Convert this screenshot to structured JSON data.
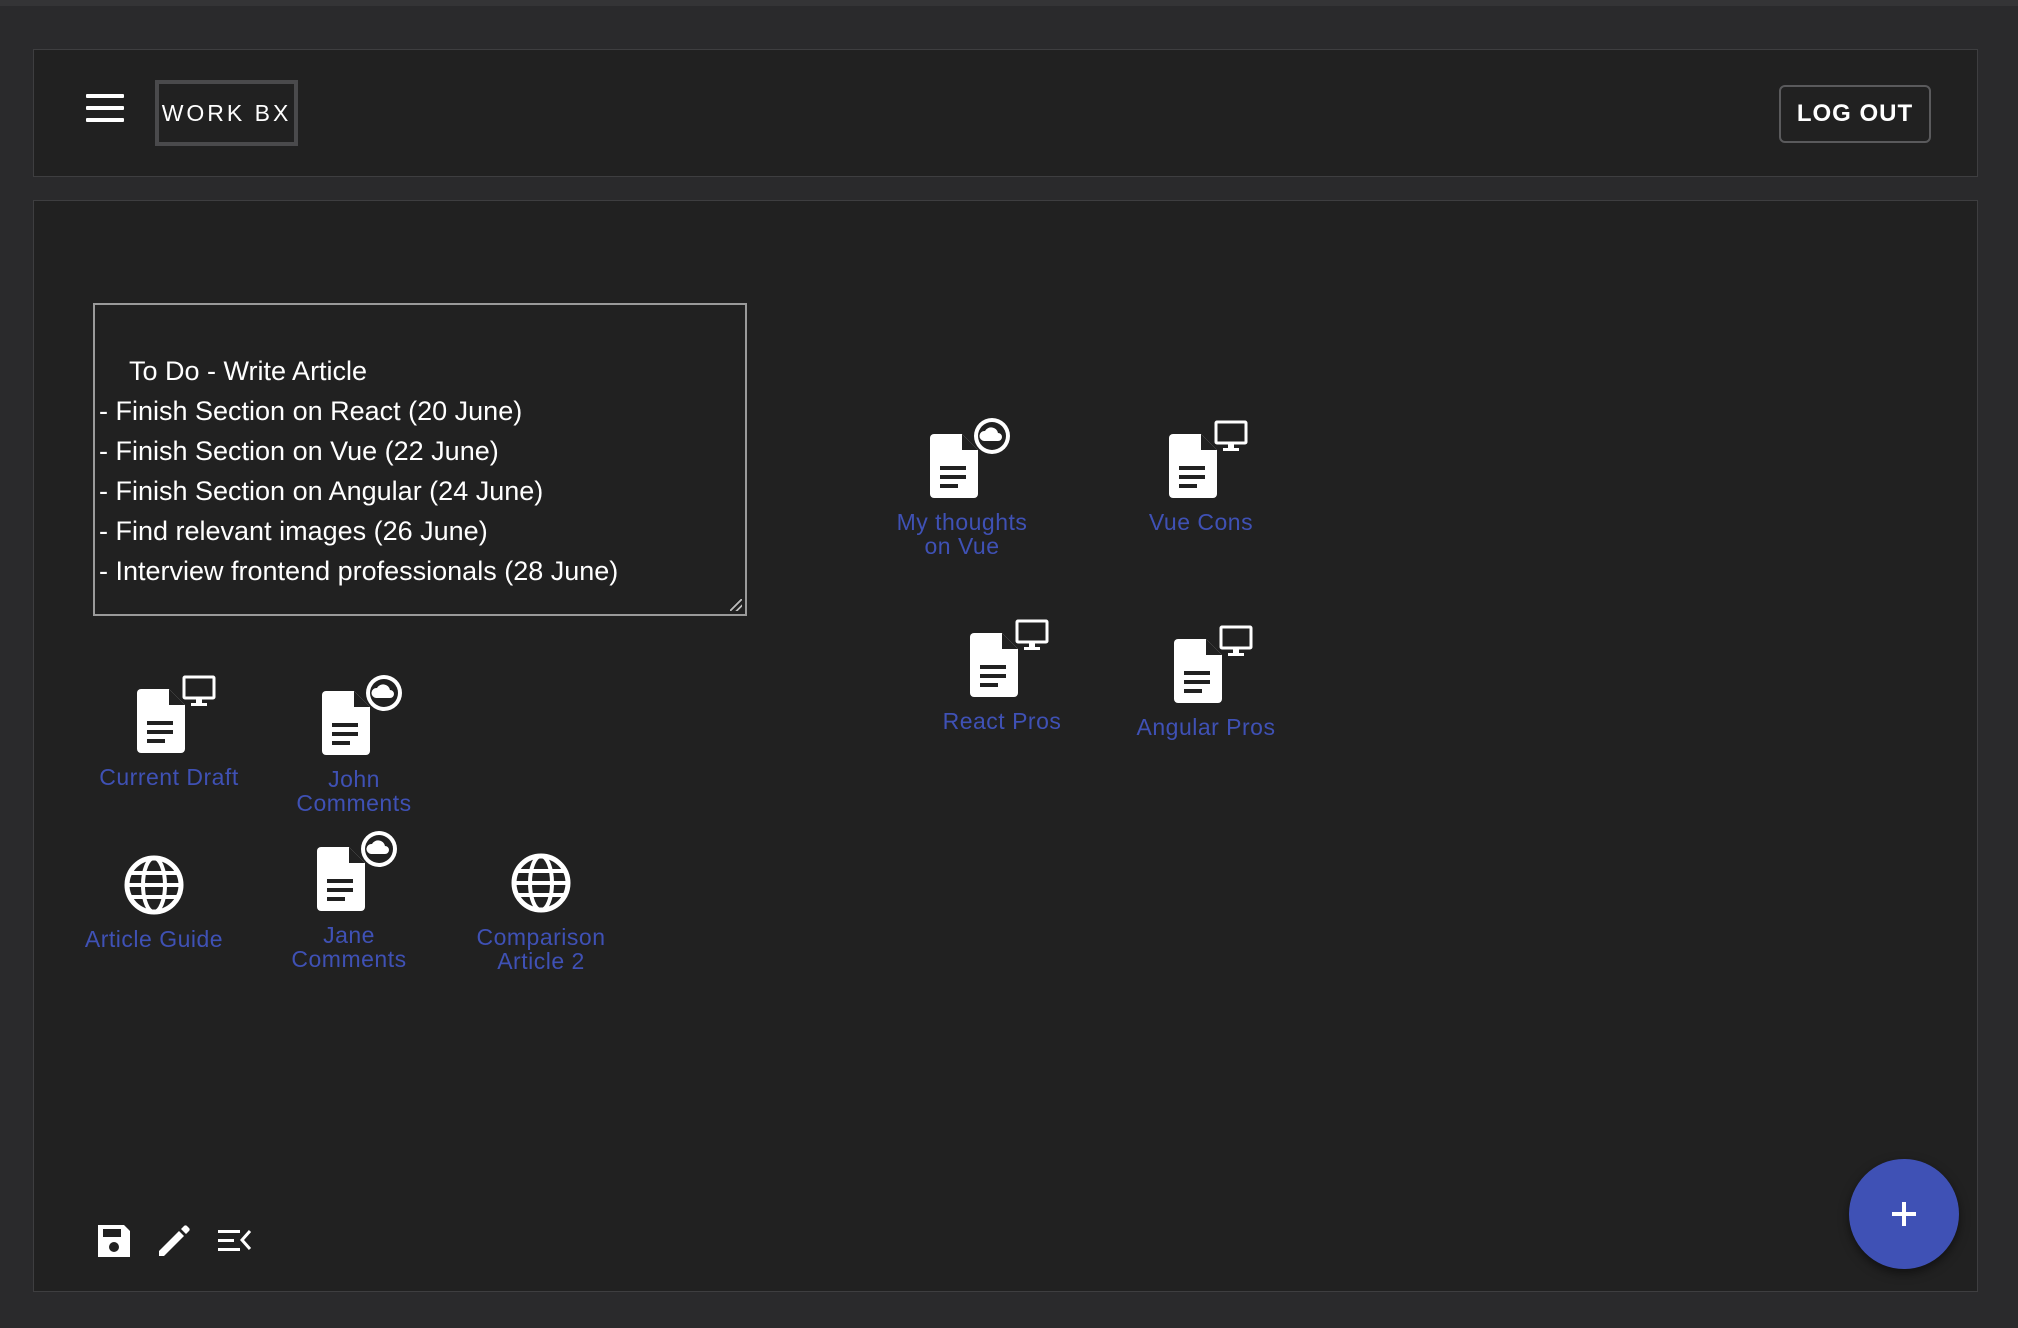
{
  "header": {
    "brand": "WORK BX",
    "logout_label": "LOG OUT"
  },
  "note": {
    "text": "To Do - Write Article\n- Finish Section on React (20 June)\n- Finish Section on Vue (22 June)\n- Finish Section on Angular (24 June)\n- Find relevant images (26 June)\n- Interview frontend professionals (28 June)"
  },
  "items": {
    "current_draft": {
      "label": "Current Draft",
      "icon": "document-desktop-icon"
    },
    "john_comments": {
      "label": "John Comments",
      "icon": "document-cloud-icon"
    },
    "article_guide": {
      "label": "Article Guide",
      "icon": "globe-icon"
    },
    "jane_comments": {
      "label": "Jane Comments",
      "icon": "document-cloud-icon"
    },
    "comparison_article_2": {
      "label": "Comparison Article 2",
      "icon": "globe-icon"
    },
    "my_thoughts_vue": {
      "label": "My thoughts on Vue",
      "icon": "document-cloud-icon"
    },
    "vue_cons": {
      "label": "Vue Cons",
      "icon": "document-desktop-icon"
    },
    "react_pros": {
      "label": "React Pros",
      "icon": "document-desktop-icon"
    },
    "angular_pros": {
      "label": "Angular Pros",
      "icon": "document-desktop-icon"
    }
  },
  "colors": {
    "accent": "#3f51b5",
    "surface": "#212121",
    "background": "#2a2a2c"
  },
  "toolbar": {
    "save_icon": "save-icon",
    "edit_icon": "pencil-icon",
    "menu_collapse_icon": "menu-collapse-icon",
    "add_icon": "plus-icon"
  }
}
